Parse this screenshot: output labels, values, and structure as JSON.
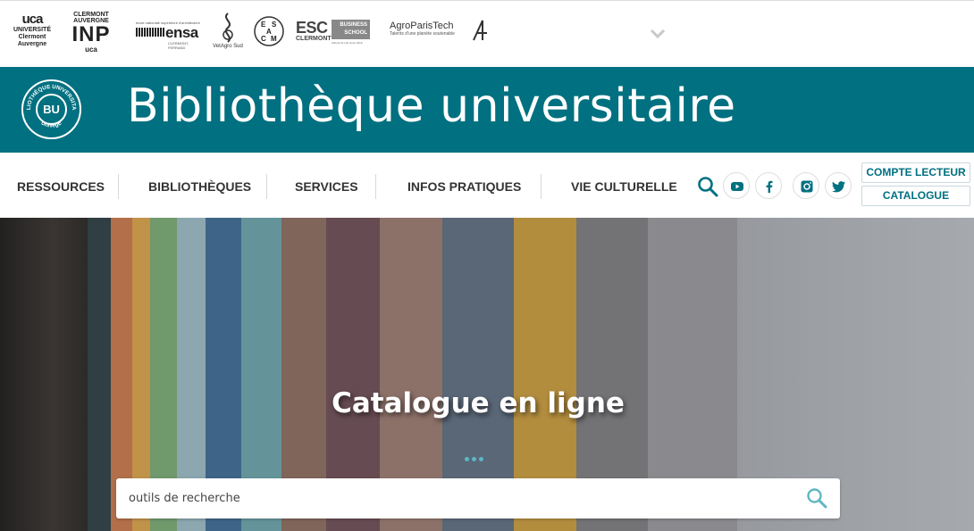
{
  "partners": {
    "logos": [
      {
        "name": "uca",
        "mark": "uca",
        "lines": [
          "UNIVERSITÉ",
          "Clermont",
          "Auvergne"
        ]
      },
      {
        "name": "inp",
        "top": "CLERMONT AUVERGNE",
        "big": "INP",
        "small": "uca"
      },
      {
        "name": "ensa",
        "tiny": "école nationale supérieure d'architecture",
        "big": "ensa",
        "sub": "CLERMONT-FERRAND"
      },
      {
        "name": "vetagro",
        "text": "VetAgro Sud"
      },
      {
        "name": "esacm",
        "letters": [
          "E",
          "S",
          "A",
          "C",
          "M"
        ]
      },
      {
        "name": "esc",
        "big": "ESC",
        "sub": "CLERMONT",
        "badge": [
          "BUSINESS",
          "SCHOOL"
        ],
        "tag": "School for Life since 1919"
      },
      {
        "name": "agroparistech",
        "big": "AgroParisTech",
        "tag": "Talents d'une planète soutenable"
      }
    ],
    "toggle_icon": "chevron-down-icon"
  },
  "banner": {
    "seal": {
      "center": "BU",
      "ring_top": "BIBLIOTHÈQUE UNIVERSITAIRE",
      "ring_bottom": "UniVegE"
    },
    "title": "Bibliothèque universitaire"
  },
  "nav": {
    "items": [
      "RESSOURCES",
      "BIBLIOTHÈQUES",
      "SERVICES",
      "INFOS PRATIQUES",
      "VIE CULTURELLE"
    ],
    "search_icon": "search-icon",
    "social": [
      "youtube-icon",
      "facebook-icon",
      "instagram-icon",
      "twitter-icon"
    ],
    "account_button": "COMPTE LECTEUR",
    "catalog_button": "CATALOGUE"
  },
  "hero": {
    "title": "Catalogue en ligne",
    "search": {
      "placeholder": "outils de recherche",
      "value": ""
    }
  },
  "colors": {
    "brand": "#017080",
    "accent": "#5fb6c2"
  }
}
